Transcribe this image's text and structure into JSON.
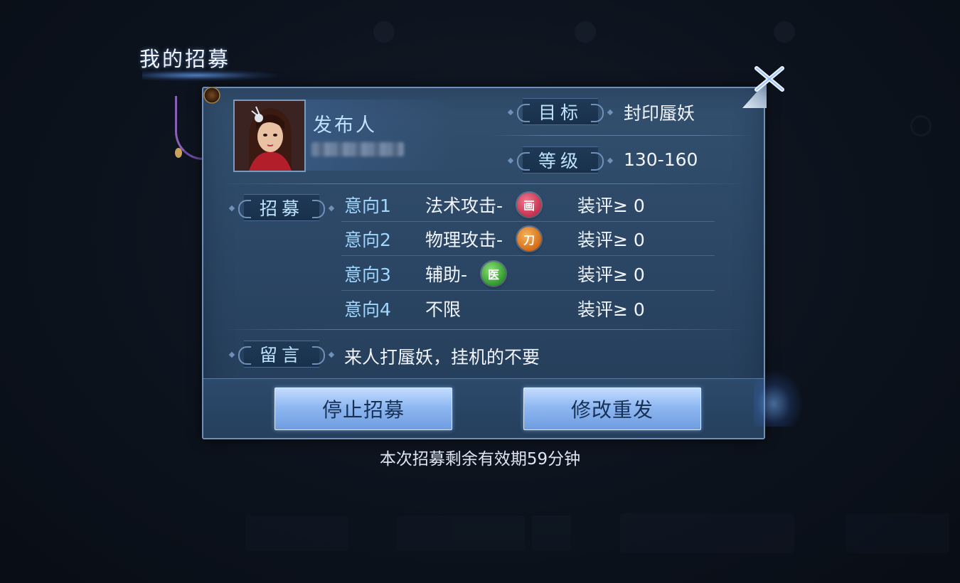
{
  "dialog": {
    "title": "我的招募",
    "publisher_label": "发布人",
    "target_label": "目标",
    "target_value": "封印蜃妖",
    "level_label": "等级",
    "level_value": "130-160",
    "recruit_label": "招募",
    "message_label": "留言",
    "message_value": "来人打蜃妖，挂机的不要",
    "intents": [
      {
        "label": "意向1",
        "class": "法术攻击-",
        "icon": "magic-attack-badge-icon",
        "icon_glyph": "画",
        "icon_color": "#d0435e",
        "score": "装评≥ 0"
      },
      {
        "label": "意向2",
        "class": "物理攻击-",
        "icon": "physical-attack-badge-icon",
        "icon_glyph": "刀",
        "icon_color": "#e17f22",
        "score": "装评≥ 0"
      },
      {
        "label": "意向3",
        "class": "辅助-",
        "icon": "support-badge-icon",
        "icon_glyph": "医",
        "icon_color": "#3fae3a",
        "score": "装评≥ 0"
      },
      {
        "label": "意向4",
        "class": "不限",
        "icon": null,
        "icon_glyph": null,
        "icon_color": null,
        "score": "装评≥ 0"
      }
    ],
    "stop_button": "停止招募",
    "modify_button": "修改重发",
    "footer_note": "本次招募剩余有效期59分钟"
  },
  "colors": {
    "panel": "#2e4a69",
    "label_blue": "#bfe2ff",
    "button": "#8fb8f2"
  }
}
